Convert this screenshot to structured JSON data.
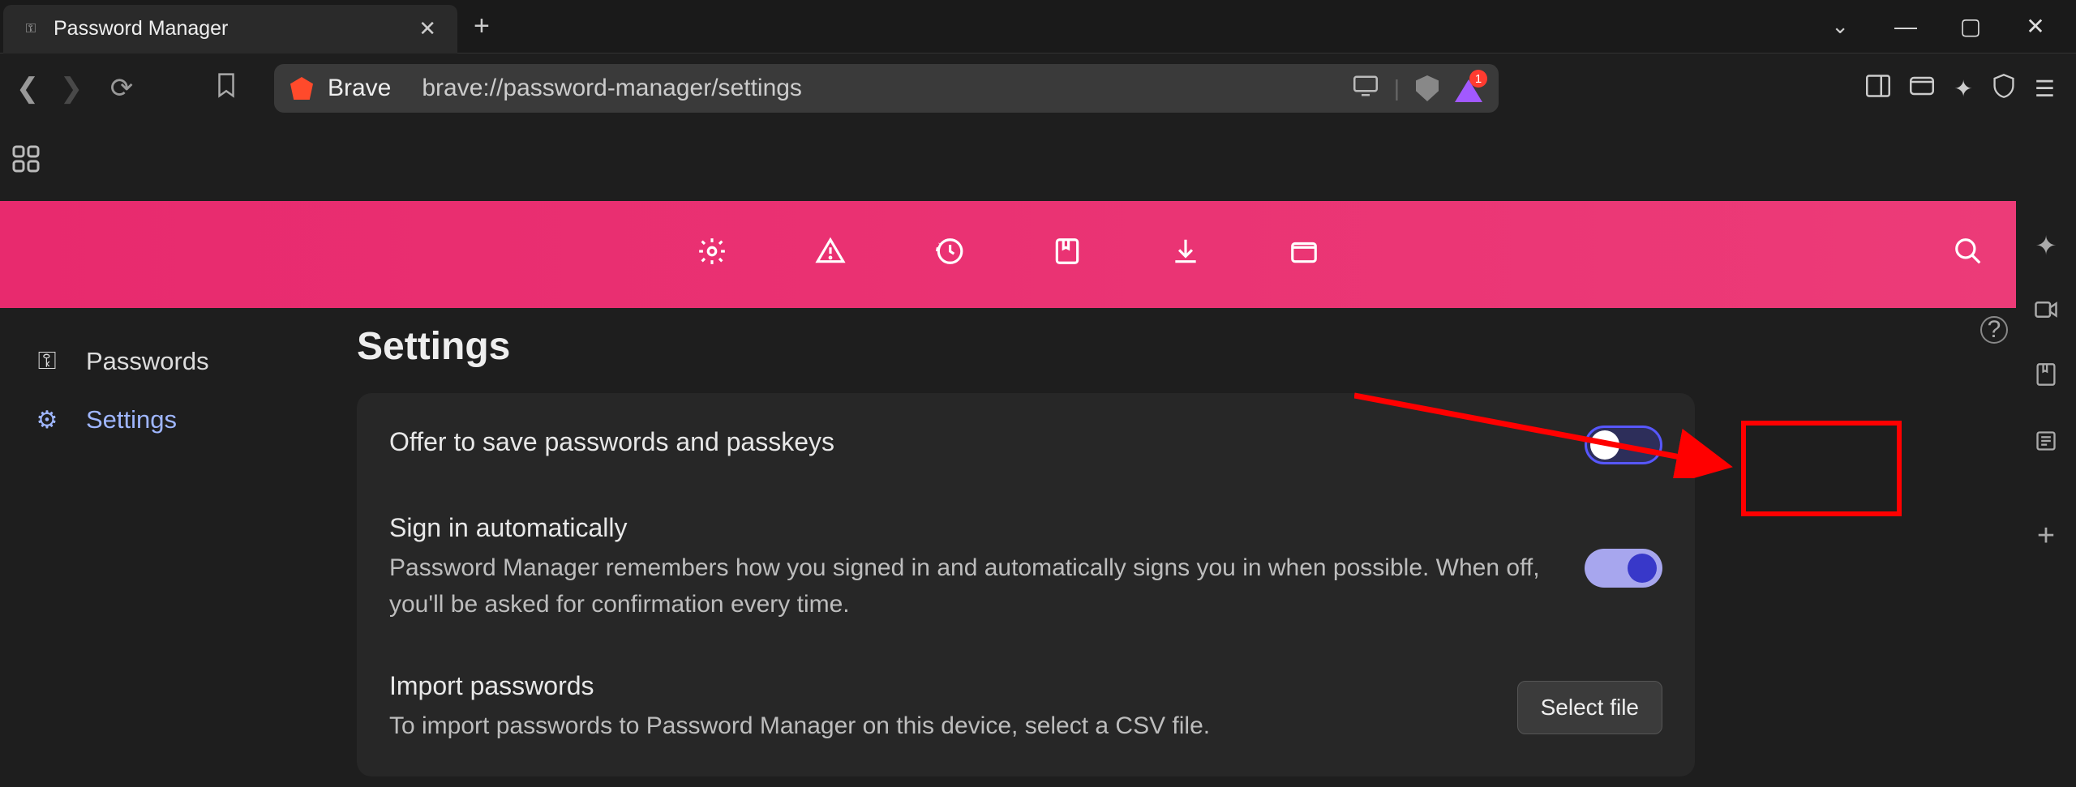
{
  "tab": {
    "title": "Password Manager"
  },
  "omnibox": {
    "brave_label": "Brave",
    "url": "brave://password-manager/settings"
  },
  "rewards_badge": "1",
  "leftnav": {
    "passwords": "Passwords",
    "settings": "Settings"
  },
  "page": {
    "title": "Settings"
  },
  "settings": {
    "offer_save": {
      "title": "Offer to save passwords and passkeys",
      "enabled": false
    },
    "auto_signin": {
      "title": "Sign in automatically",
      "desc": "Password Manager remembers how you signed in and automatically signs you in when possible. When off, you'll be asked for confirmation every time.",
      "enabled": true
    },
    "import": {
      "title": "Import passwords",
      "desc": "To import passwords to Password Manager on this device, select a CSV file.",
      "button": "Select file"
    }
  }
}
